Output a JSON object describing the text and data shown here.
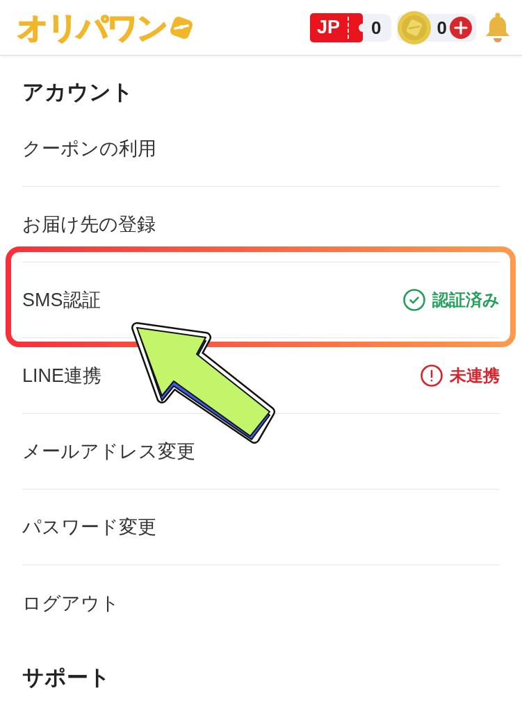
{
  "header": {
    "logo": "オリパワン",
    "ticket": {
      "label": "JP",
      "count": "0"
    },
    "coins": {
      "count": "0"
    }
  },
  "sections": [
    {
      "heading": "アカウント",
      "items": [
        {
          "label": "クーポンの利用",
          "highlighted": false
        },
        {
          "label": "お届け先の登録",
          "highlighted": false
        },
        {
          "label": "SMS認証",
          "highlighted": true,
          "status": {
            "kind": "verified",
            "label": "認証済み"
          }
        },
        {
          "label": "LINE連携",
          "highlighted": false,
          "status": {
            "kind": "unlinked",
            "label": "未連携"
          }
        },
        {
          "label": "メールアドレス変更",
          "highlighted": false
        },
        {
          "label": "パスワード変更",
          "highlighted": false
        },
        {
          "label": "ログアウト",
          "highlighted": false
        }
      ]
    },
    {
      "heading": "サポート"
    }
  ]
}
